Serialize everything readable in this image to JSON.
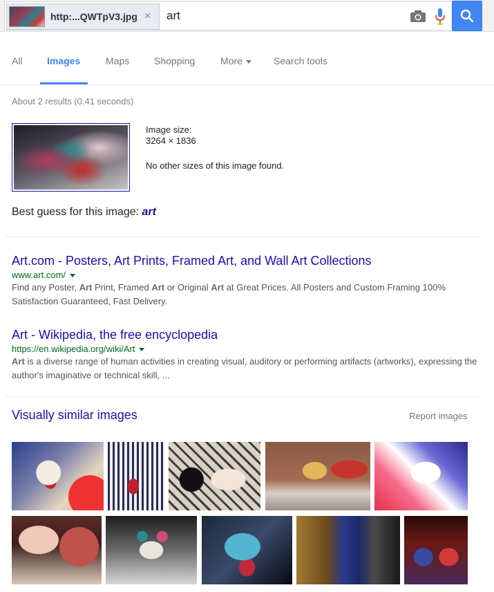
{
  "search": {
    "chip_label": "http:...QWTpV3.jpg",
    "chip_close": "×",
    "query": "art"
  },
  "tabs": [
    {
      "label": "All"
    },
    {
      "label": "Images"
    },
    {
      "label": "Maps"
    },
    {
      "label": "Shopping"
    },
    {
      "label": "More"
    },
    {
      "label": "Search tools"
    }
  ],
  "stats": "About 2 results (0.41 seconds)",
  "image_info": {
    "size_label": "Image size:",
    "size_value": "3264 × 1836",
    "no_sizes": "No other sizes of this image found."
  },
  "best_guess": {
    "prefix": "Best guess for this image: ",
    "term": "art"
  },
  "results": [
    {
      "title": "Art.com - Posters, Art Prints, Framed Art, and Wall Art Collections",
      "url": "www.art.com/",
      "snippet_parts": [
        "Find any Poster, ",
        "Art",
        " Print, Framed ",
        "Art",
        " or Original ",
        "Art",
        " at Great Prices. All Posters and Custom Framing 100% Satisfaction Guaranteed, Fast Delivery."
      ]
    },
    {
      "title": "Art - Wikipedia, the free encyclopedia",
      "url": "https://en.wikipedia.org/wiki/Art",
      "snippet_parts": [
        "Art",
        " is a diverse range of human activities in creating visual, auditory or performing artifacts (artworks), expressing the author's imaginative or technical skill, ..."
      ]
    }
  ],
  "similar": {
    "title": "Visually similar images",
    "report": "Report images"
  },
  "colors": {
    "accent": "#4285f4",
    "link": "#1a0dab",
    "url_green": "#006621"
  }
}
